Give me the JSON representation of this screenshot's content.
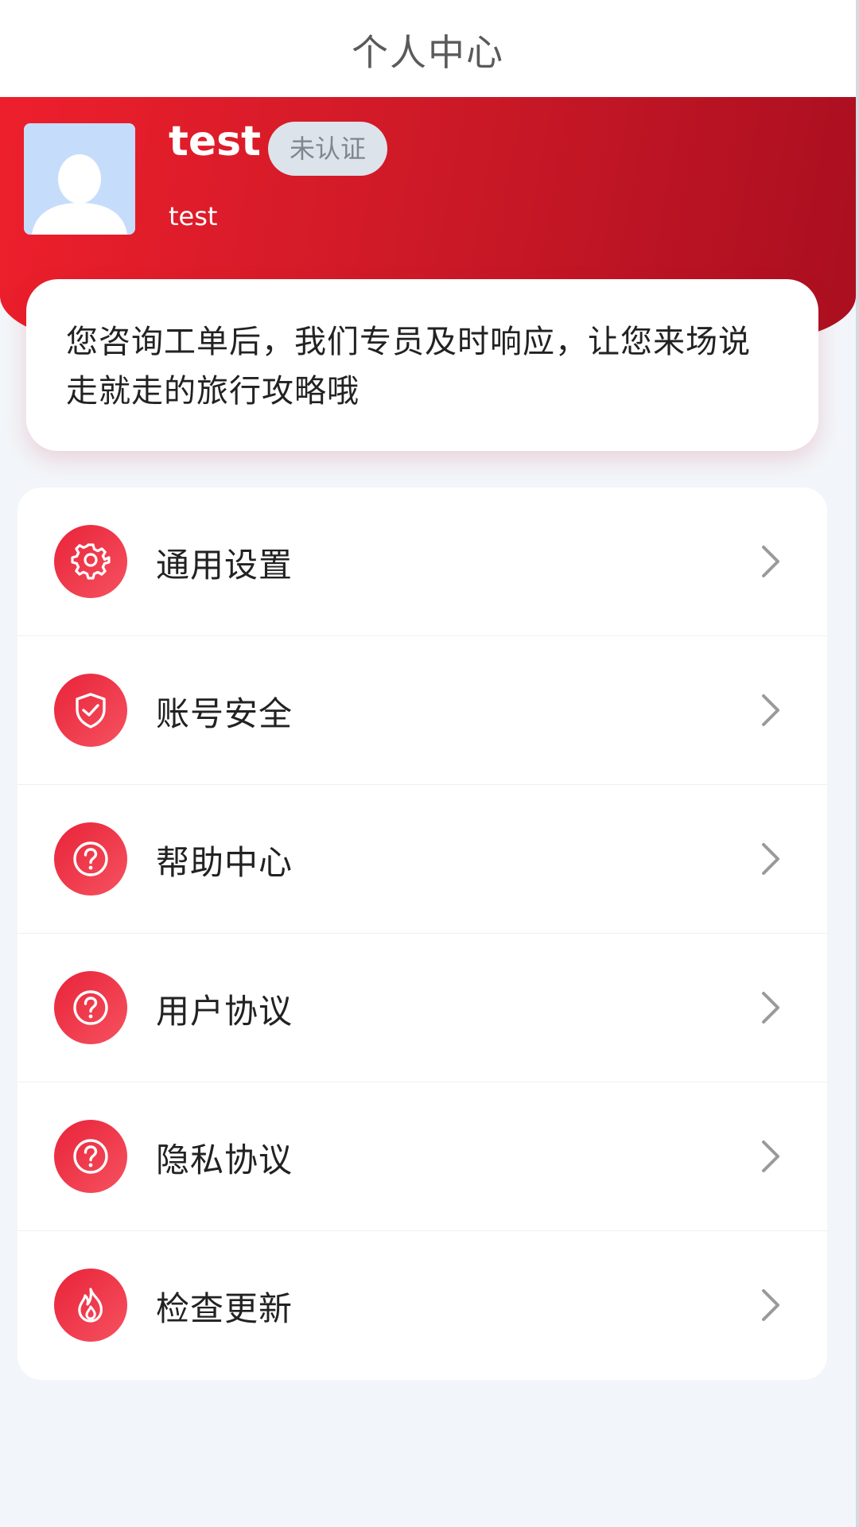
{
  "navbar": {
    "title": "个人中心"
  },
  "profile": {
    "name": "test",
    "badge": "未认证",
    "account": "test"
  },
  "notice": {
    "text": "您咨询工单后，我们专员及时响应，让您来场说走就走的旅行攻略哦"
  },
  "menu": {
    "items": [
      {
        "label": "通用设置",
        "icon": "gear-icon"
      },
      {
        "label": "账号安全",
        "icon": "shield-check-icon"
      },
      {
        "label": "帮助中心",
        "icon": "question-circle-icon"
      },
      {
        "label": "用户协议",
        "icon": "question-circle-icon"
      },
      {
        "label": "隐私协议",
        "icon": "question-circle-icon"
      },
      {
        "label": "检查更新",
        "icon": "flame-icon"
      }
    ]
  },
  "colors": {
    "brand_red": "#e9233a",
    "header_dark": "#aa0f20",
    "badge_bg": "#dde3ea",
    "page_bg": "#f2f5f9"
  }
}
